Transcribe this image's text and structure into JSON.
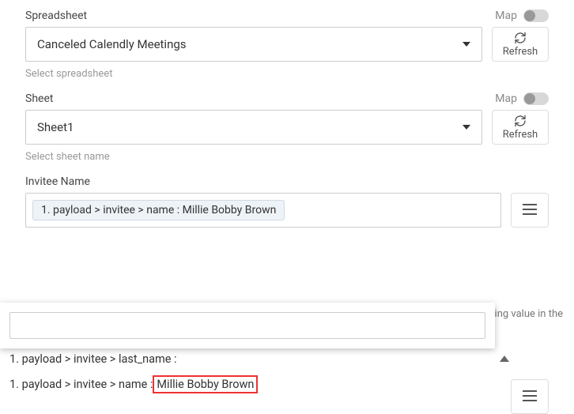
{
  "spreadsheet": {
    "label": "Spreadsheet",
    "map_label": "Map",
    "value": "Canceled Calendly Meetings",
    "refresh_label": "Refresh",
    "helper": "Select spreadsheet"
  },
  "sheet": {
    "label": "Sheet",
    "map_label": "Map",
    "value": "Sheet1",
    "refresh_label": "Refresh",
    "helper": "Select sheet name"
  },
  "invitee": {
    "label": "Invitee Name",
    "pill_text": "1. payload > invitee > name : Millie Bobby Brown",
    "note": "he existing value in the"
  },
  "dropdown": {
    "search_placeholder": ""
  },
  "suggestions": [
    {
      "full": "1. payload > invitee > last_name :",
      "highlight": ""
    },
    {
      "prefix": "1. payload > invitee > name : ",
      "highlight": "Millie Bobby Brown"
    }
  ]
}
